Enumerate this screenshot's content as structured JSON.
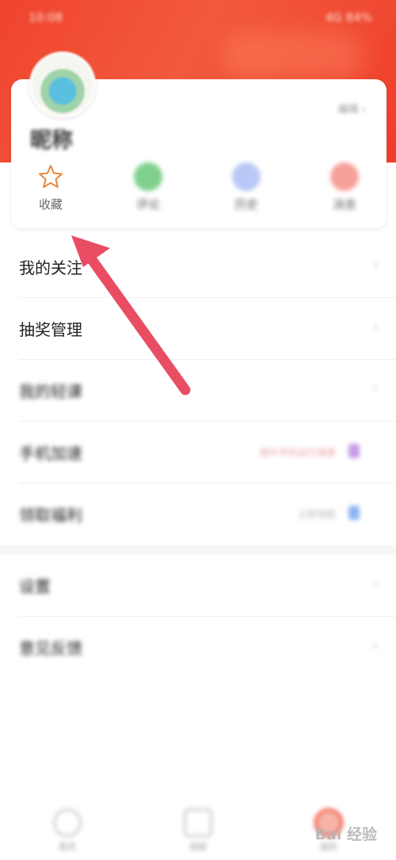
{
  "status_bar": {
    "time": "10:08",
    "indicators": "4G 84%"
  },
  "profile": {
    "username": "昵称",
    "edit_link": "编辑 ›"
  },
  "quick_actions": [
    {
      "label": "收藏",
      "icon": "star-icon"
    },
    {
      "label": "评论",
      "icon": "comment-icon"
    },
    {
      "label": "历史",
      "icon": "history-icon"
    },
    {
      "label": "消息",
      "icon": "message-icon"
    }
  ],
  "menu": {
    "items": [
      {
        "label": "我的关注"
      },
      {
        "label": "抽奖管理"
      },
      {
        "label": "我的轻课"
      },
      {
        "label": "手机加速",
        "extra": "提升手机运行速度"
      },
      {
        "label": "领取福利",
        "extra": "立即领取"
      },
      {
        "label": "设置"
      },
      {
        "label": "意见反馈"
      }
    ]
  },
  "tabbar": {
    "tabs": [
      {
        "label": "首页"
      },
      {
        "label": "视频"
      },
      {
        "label": "我的"
      }
    ]
  },
  "watermark": "Bai 经验",
  "colors": {
    "header": "#f0442e",
    "accent_star": "#e8883a",
    "arrow": "#e94d63"
  }
}
